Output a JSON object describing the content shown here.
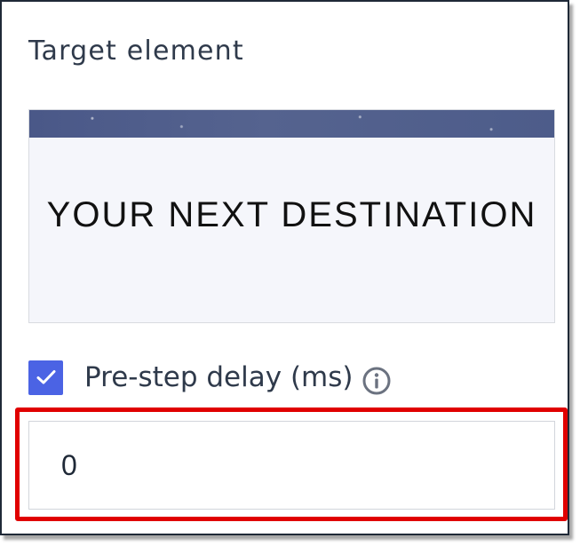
{
  "panel": {
    "section_title": "Target element"
  },
  "preview": {
    "text": "YOUR NEXT DESTINATION"
  },
  "delay": {
    "checked": true,
    "label": "Pre-step delay (ms)",
    "value": "0",
    "info_icon": "info-circle-icon",
    "check_icon": "checkmark-icon"
  },
  "colors": {
    "checkbox": "#4b63e4",
    "highlight": "#e00000",
    "title_text": "#2f3a4b",
    "banner": "#55638f"
  }
}
